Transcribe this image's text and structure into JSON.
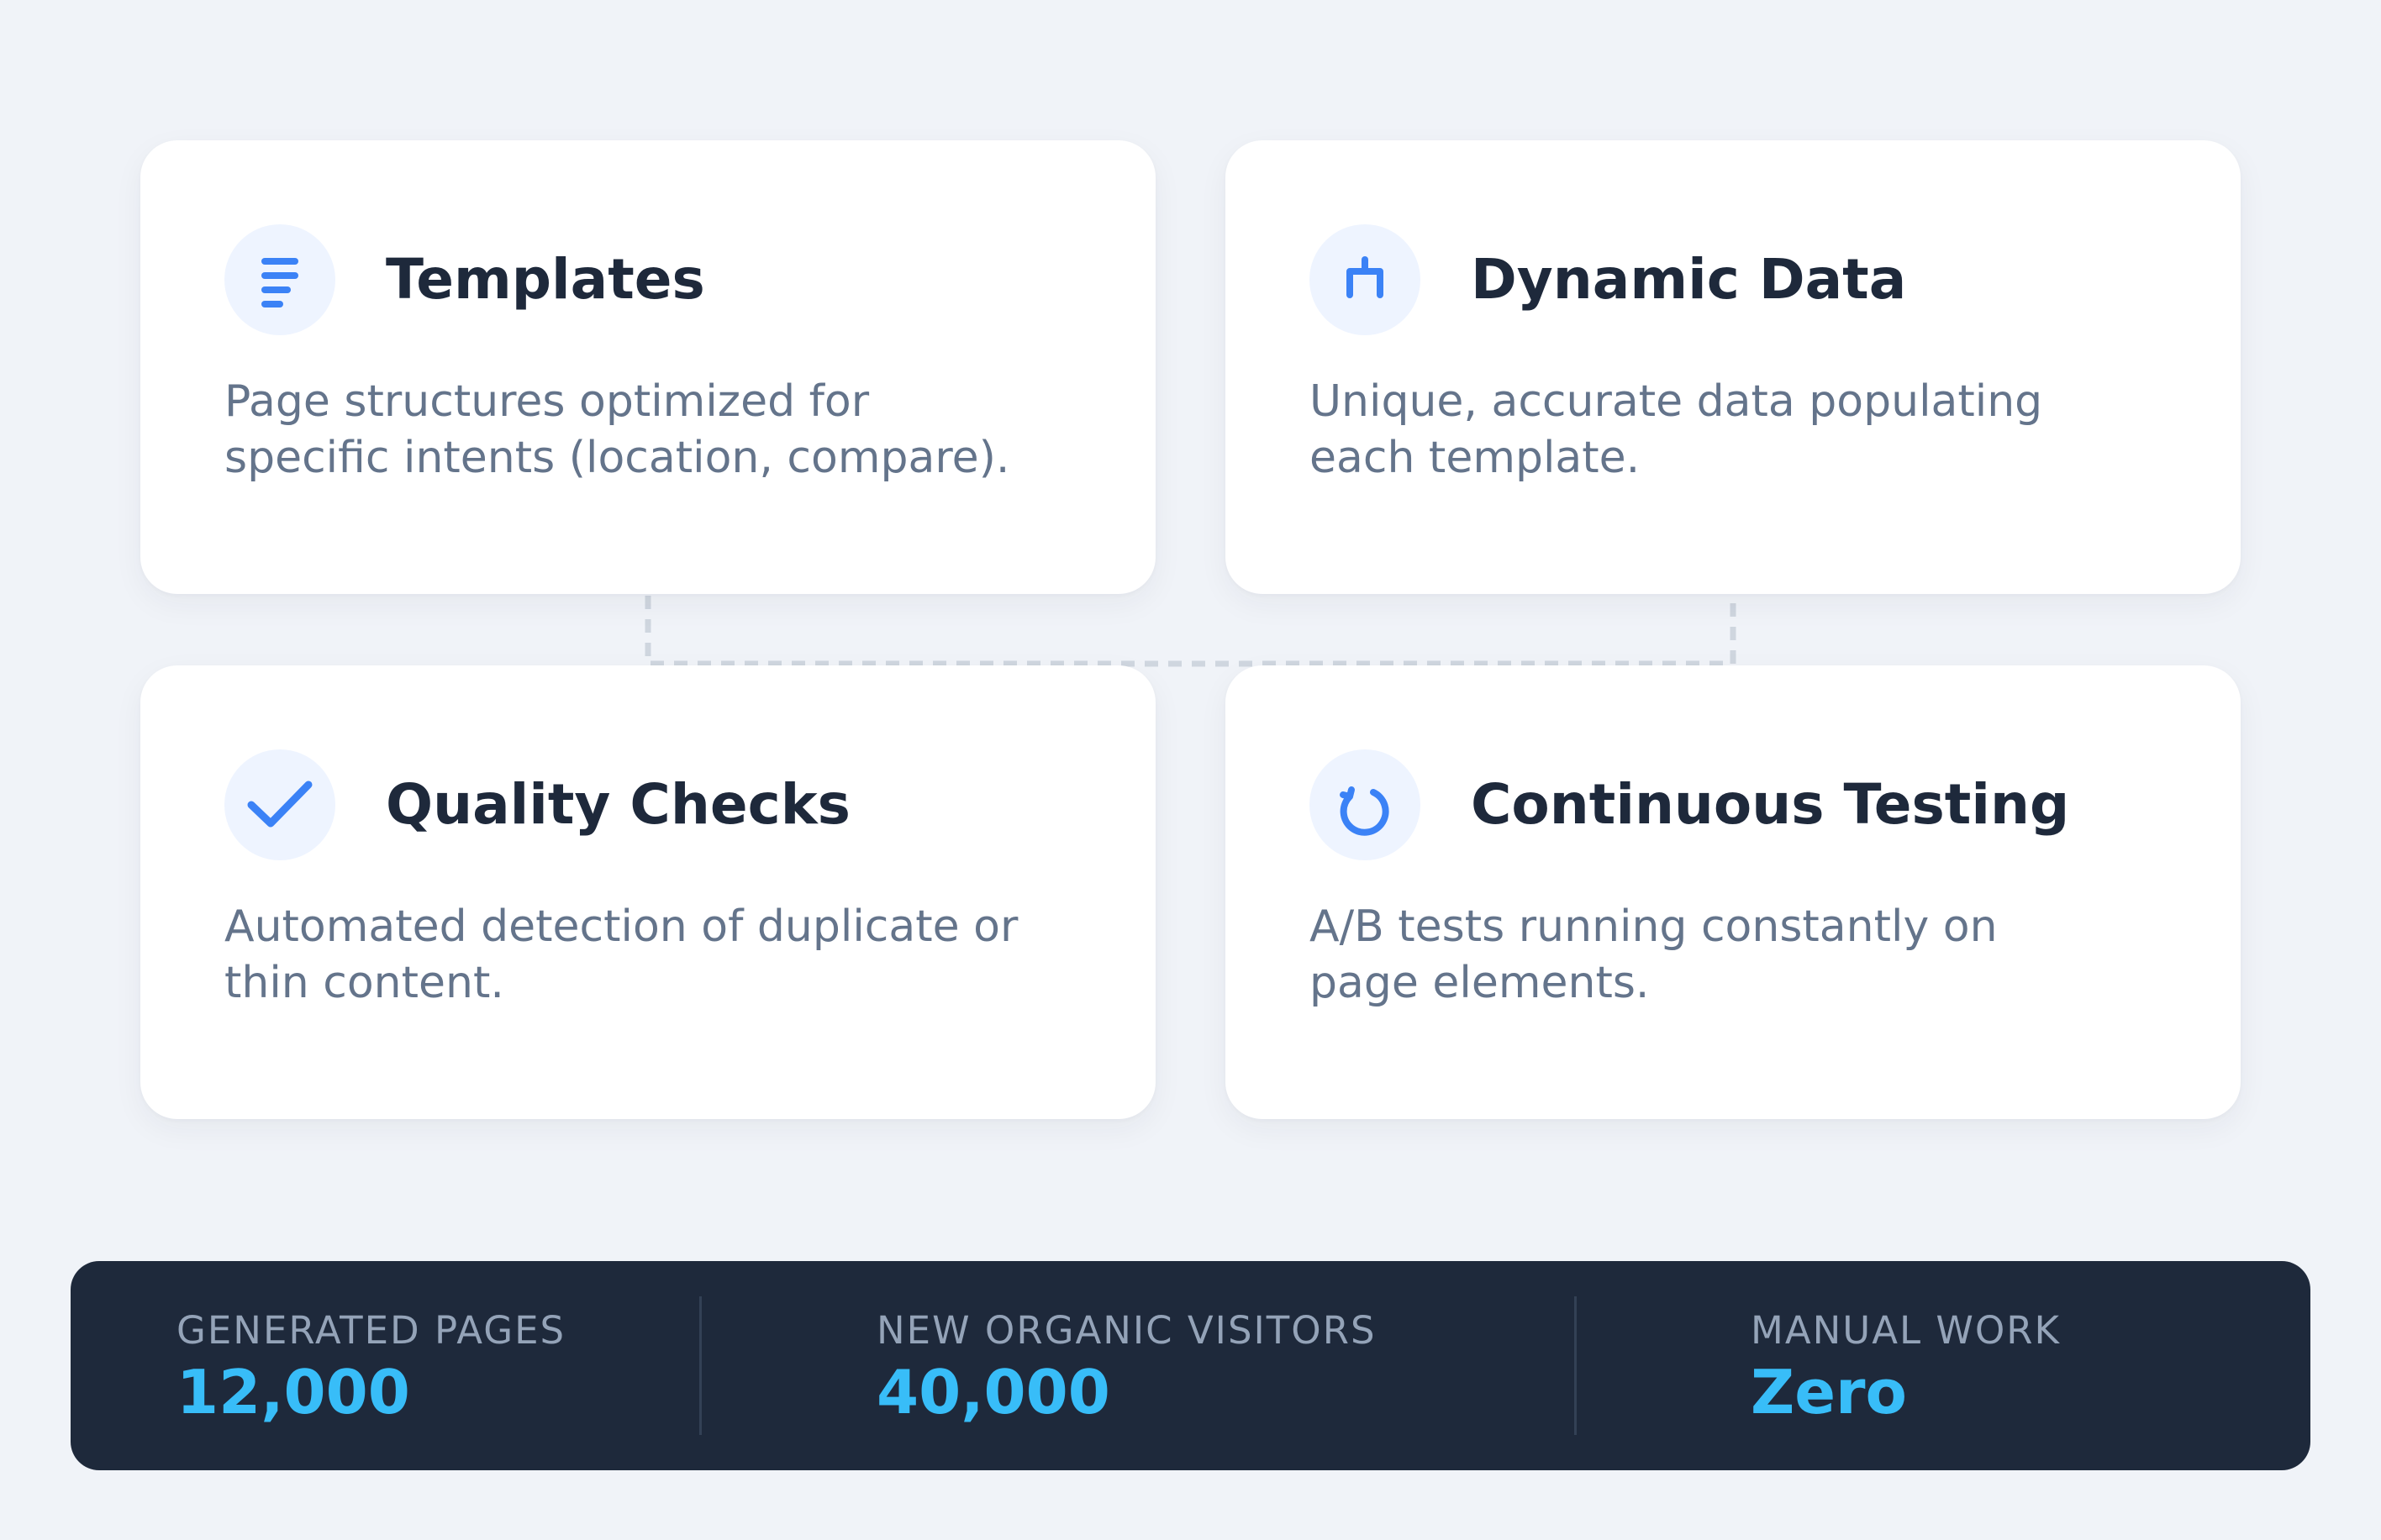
{
  "cards": [
    {
      "title": "Templates",
      "description": "Page structures optimized for specific intents (location, compare).",
      "icon": "list-icon"
    },
    {
      "title": "Dynamic Data",
      "description": "Unique, accurate data populating each template.",
      "icon": "plug-icon"
    },
    {
      "title": "Quality Checks",
      "description": "Automated detection of duplicate or thin content.",
      "icon": "check-icon"
    },
    {
      "title": "Continuous Testing",
      "description": "A/B tests running constantly on page elements.",
      "icon": "refresh-icon"
    }
  ],
  "stats": [
    {
      "label": "GENERATED PAGES",
      "value": "12,000"
    },
    {
      "label": "NEW ORGANIC VISITORS",
      "value": "40,000"
    },
    {
      "label": "MANUAL WORK",
      "value": "Zero"
    }
  ],
  "colors": {
    "background": "#f0f3f8",
    "card": "#ffffff",
    "icon_accent": "#3b82f6",
    "icon_badge": "#eef4ff",
    "title": "#1e293b",
    "description": "#64748b",
    "stats_bar": "#1e293b",
    "stat_label": "#94a3b8",
    "stat_value": "#38bdf8"
  }
}
